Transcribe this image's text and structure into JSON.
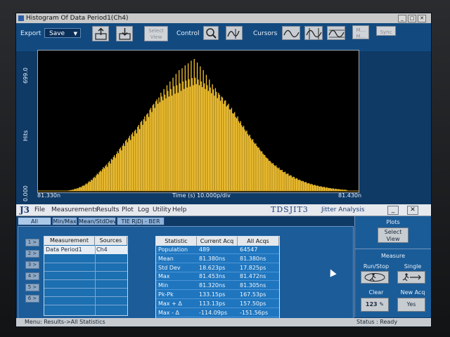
{
  "plot_window": {
    "title": "Histogram Of Data Period1(Ch4)",
    "export_label": "Export",
    "export_value": "Save",
    "select_view_label": "Select View",
    "control_label": "Control",
    "cursors_label": "Cursors",
    "btn_m_label": "M… M…",
    "btn_sync_label": "Sync"
  },
  "chart_data": {
    "type": "histogram",
    "y_axis_label": "Hits",
    "y_max_label": "699.0",
    "y_min_label": "0.000",
    "ylim": [
      0,
      699
    ],
    "x_min_label": "81.330n",
    "x_max_label": "81.430n",
    "x_axis_text": "Time (s)  10.000p/div",
    "bar_color": "#f6c431",
    "bins": [
      2,
      3,
      5,
      4,
      7,
      6,
      9,
      12,
      10,
      15,
      14,
      18,
      22,
      19,
      25,
      30,
      27,
      34,
      40,
      36,
      45,
      52,
      48,
      60,
      57,
      68,
      75,
      70,
      83,
      92,
      88,
      100,
      108,
      103,
      115,
      126,
      120,
      132,
      140,
      128,
      150,
      158,
      145,
      170,
      165,
      180,
      190,
      176,
      196,
      210,
      200,
      222,
      230,
      215,
      240,
      252,
      238,
      265,
      272,
      258,
      280,
      292,
      270,
      300,
      310,
      290,
      318,
      325,
      305,
      340,
      350,
      328,
      365,
      372,
      350,
      380,
      395,
      370,
      405,
      412,
      392,
      430,
      440,
      418,
      455,
      462,
      440,
      475,
      485,
      462,
      495,
      470,
      520,
      500,
      480,
      540,
      510,
      490,
      560,
      530,
      500,
      580,
      540,
      505,
      600,
      555,
      515,
      620,
      560,
      520,
      640,
      570,
      530,
      650,
      580,
      540,
      665,
      585,
      548,
      676,
      592,
      553,
      690,
      598,
      560,
      699,
      600,
      566,
      680,
      590,
      560,
      660,
      580,
      550,
      640,
      570,
      540,
      615,
      560,
      530,
      590,
      548,
      518,
      565,
      538,
      505,
      545,
      525,
      492,
      520,
      510,
      478,
      500,
      495,
      462,
      478,
      480,
      448,
      455,
      462,
      432,
      432,
      440,
      412,
      410,
      418,
      392,
      385,
      395,
      370,
      360,
      370,
      348,
      338,
      345,
      325,
      315,
      320,
      302,
      292,
      298,
      280,
      270,
      275,
      258,
      250,
      252,
      238,
      230,
      230,
      218,
      210,
      210,
      198,
      192,
      190,
      178,
      175,
      170,
      160,
      160,
      152,
      145,
      148,
      138,
      132,
      136,
      125,
      120,
      124,
      112,
      110,
      112,
      100,
      100,
      102,
      90,
      92,
      92,
      80,
      84,
      82,
      72,
      76,
      74,
      64,
      68,
      66,
      58,
      60,
      58,
      52,
      54,
      52,
      46,
      48,
      46,
      40,
      42,
      40,
      35,
      38,
      35,
      30,
      33,
      31,
      27,
      29,
      27,
      23,
      25,
      24,
      20,
      22,
      21,
      17,
      19,
      18,
      15,
      16,
      15,
      12,
      14,
      13,
      10,
      12,
      11,
      9,
      10,
      9,
      7,
      8,
      7,
      6,
      7,
      6,
      5
    ]
  },
  "j3_window": {
    "logo": "J3",
    "menu": [
      "File",
      "Measurements",
      "Results",
      "Plot",
      "Log",
      "Utility",
      "Help"
    ],
    "title": "TDSJIT3",
    "subtitle": "Jitter Analysis",
    "tabs": [
      "All Statistics",
      "Min/Max",
      "Mean/StdDev",
      "TIE RjDj - BER"
    ],
    "row_buttons": [
      "1 >",
      "2 >",
      "3 >",
      "4 >",
      "5 >",
      "6 >"
    ],
    "measurements_headers": [
      "Measurement",
      "Sources"
    ],
    "measurements_rows": [
      [
        "Data Period1",
        "Ch4"
      ]
    ],
    "stats_headers": [
      "Statistic",
      "Current Acq",
      "All Acqs"
    ],
    "stats_rows": [
      [
        "Population",
        "489",
        "64547"
      ],
      [
        "Mean",
        "81.380ns",
        "81.380ns"
      ],
      [
        "Std Dev",
        "18.623ps",
        "17.825ps"
      ],
      [
        "Max",
        "81.453ns",
        "81.472ns"
      ],
      [
        "Min",
        "81.320ns",
        "81.305ns"
      ],
      [
        "Pk-Pk",
        "133.15ps",
        "167.53ps"
      ],
      [
        "Max + Δ",
        "113.13ps",
        "157.50ps"
      ],
      [
        "Max - Δ",
        "-114.09ps",
        "-151.56ps"
      ]
    ],
    "plots_label": "Plots",
    "plots_select_view": "Select View",
    "measure_label": "Measure",
    "run_stop_label": "Run/Stop",
    "single_label": "Single",
    "clear_label": "Clear",
    "new_acq_label": "New Acq",
    "yes_label": "Yes",
    "clear_icon_text": "123",
    "status_menu": "Menu: Results->All Statistics",
    "status_text": "Status : Ready"
  }
}
